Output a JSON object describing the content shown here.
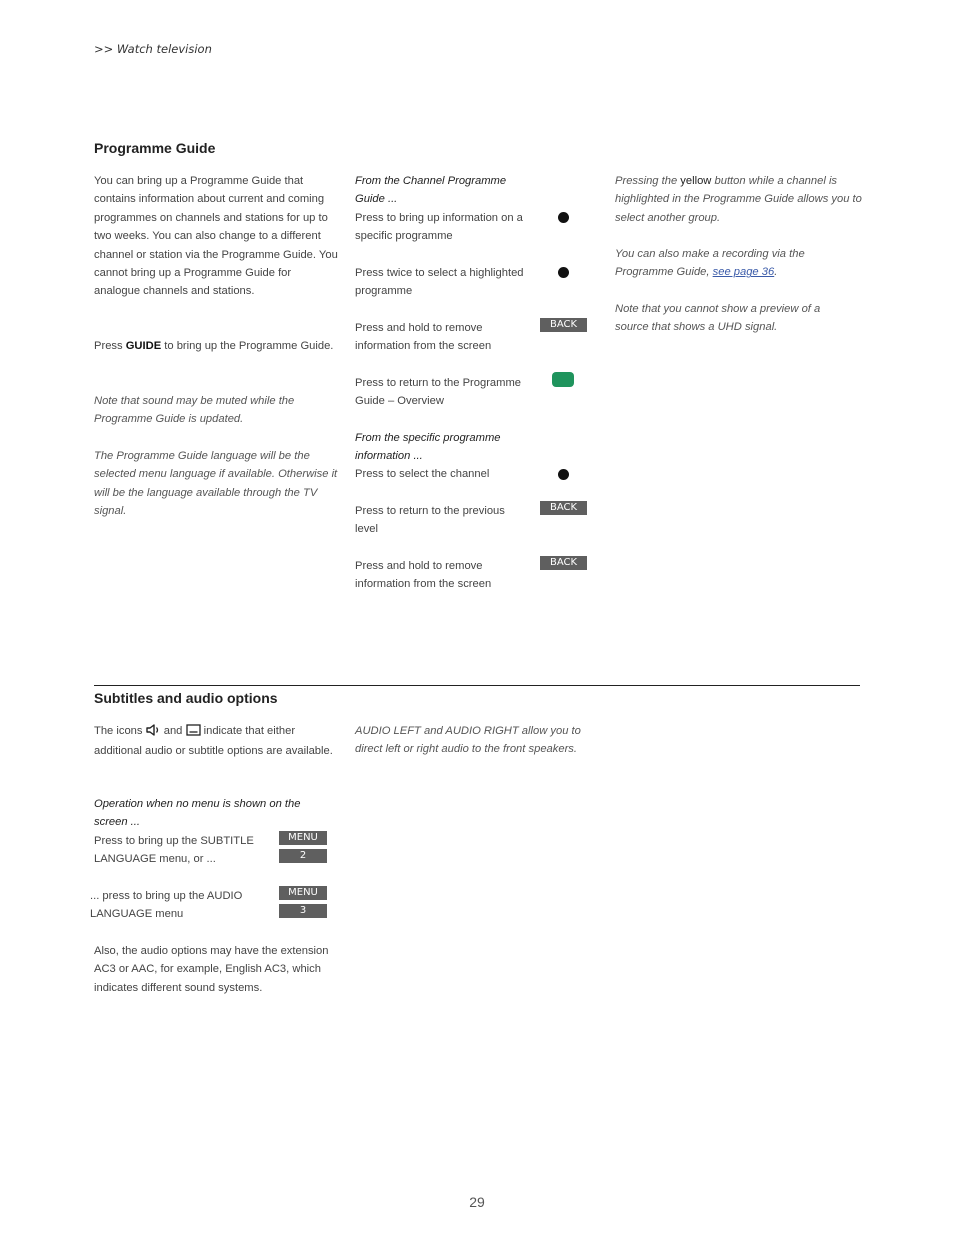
{
  "breadcrumb": ">> Watch television",
  "programme_guide": {
    "title": "Programme Guide",
    "col1": {
      "intro": "You can bring up a Programme Guide that contains information about current and coming programmes on channels and stations for up to two weeks. You can also change to a different channel or station via the Programme Guide. You cannot bring up a Programme Guide for analogue channels and stations.",
      "press_prefix": "Press ",
      "press_key": "GUIDE",
      "press_suffix": " to bring up the Programme Guide.",
      "note1": "Note that sound may be muted while the Programme Guide is updated.",
      "note2": "The Programme Guide language will be the selected menu language if available. Otherwise it will be the language available through the TV signal."
    },
    "col2": {
      "section1_heading": "From the Channel Programme Guide ...",
      "rows1": [
        {
          "text": "Press to bring up information on a specific programme",
          "key_type": "center-button",
          "key_label": ""
        },
        {
          "text": "Press twice to select a highlighted programme",
          "key_type": "center-button",
          "key_label": ""
        },
        {
          "text": "Press and hold to remove information from the screen",
          "key_type": "text-key",
          "key_label": "BACK"
        },
        {
          "text": "Press to return to the Programme Guide – Overview",
          "key_type": "green-button",
          "key_label": ""
        }
      ],
      "section2_heading": "From the specific programme information ...",
      "rows2": [
        {
          "text": "Press to select the channel",
          "key_type": "center-button",
          "key_label": ""
        },
        {
          "text": "Press to return to the previous level",
          "key_type": "text-key",
          "key_label": "BACK"
        },
        {
          "text": "Press and hold to remove information from the screen",
          "key_type": "text-key",
          "key_label": "BACK"
        }
      ]
    },
    "col3": {
      "note1_prefix": "Pressing the ",
      "note1_bold": "yellow",
      "note1_suffix": " button while a channel is highlighted in the Programme Guide allows you to select another group.",
      "note2_prefix": "You can also make a recording via the Programme Guide, ",
      "note2_link": "see page 36",
      "note2_suffix": ".",
      "note3": "Note that you cannot show a preview of a source that shows a UHD signal."
    }
  },
  "subtitles": {
    "title": "Subtitles and audio options",
    "intro_prefix": "The icons ",
    "intro_mid": " and ",
    "intro_suffix": " indicate that either additional audio or subtitle options are available.",
    "icons": [
      "speaker-audio-icon",
      "subtitle-icon"
    ],
    "operation_heading": "Operation when no menu is shown on the screen ...",
    "rows": [
      {
        "text": "Press to bring up the SUBTITLE LANGUAGE menu, or ...",
        "keys": [
          "MENU",
          "2"
        ]
      },
      {
        "text": "... press to bring up the AUDIO LANGUAGE menu",
        "keys": [
          "MENU",
          "3"
        ]
      }
    ],
    "extension_note": "Also, the audio options may have the extension AC3 or AAC, for example, English AC3, which indicates different sound systems.",
    "audio_note": "AUDIO LEFT and AUDIO RIGHT allow you to direct left or right audio to the front speakers."
  },
  "page_number": "29",
  "colors": {
    "green_button": "#1f945d",
    "key_background": "#5f5f5f",
    "link": "#3a5aa8"
  }
}
